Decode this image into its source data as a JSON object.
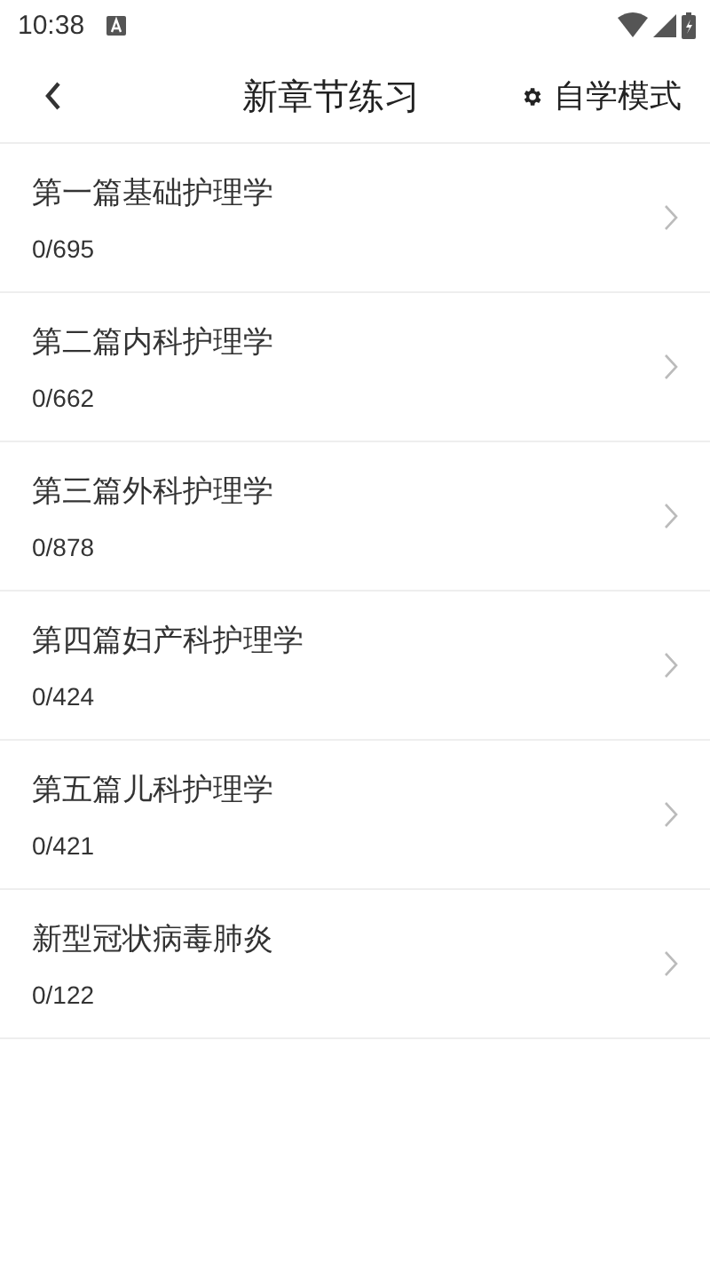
{
  "status_bar": {
    "time": "10:38"
  },
  "header": {
    "title": "新章节练习",
    "action": "自学模式"
  },
  "chapters": [
    {
      "title": "第一篇基础护理学",
      "progress": "0/695"
    },
    {
      "title": "第二篇内科护理学",
      "progress": "0/662"
    },
    {
      "title": "第三篇外科护理学",
      "progress": "0/878"
    },
    {
      "title": "第四篇妇产科护理学",
      "progress": "0/424"
    },
    {
      "title": "第五篇儿科护理学",
      "progress": "0/421"
    },
    {
      "title": "新型冠状病毒肺炎",
      "progress": "0/122"
    }
  ]
}
